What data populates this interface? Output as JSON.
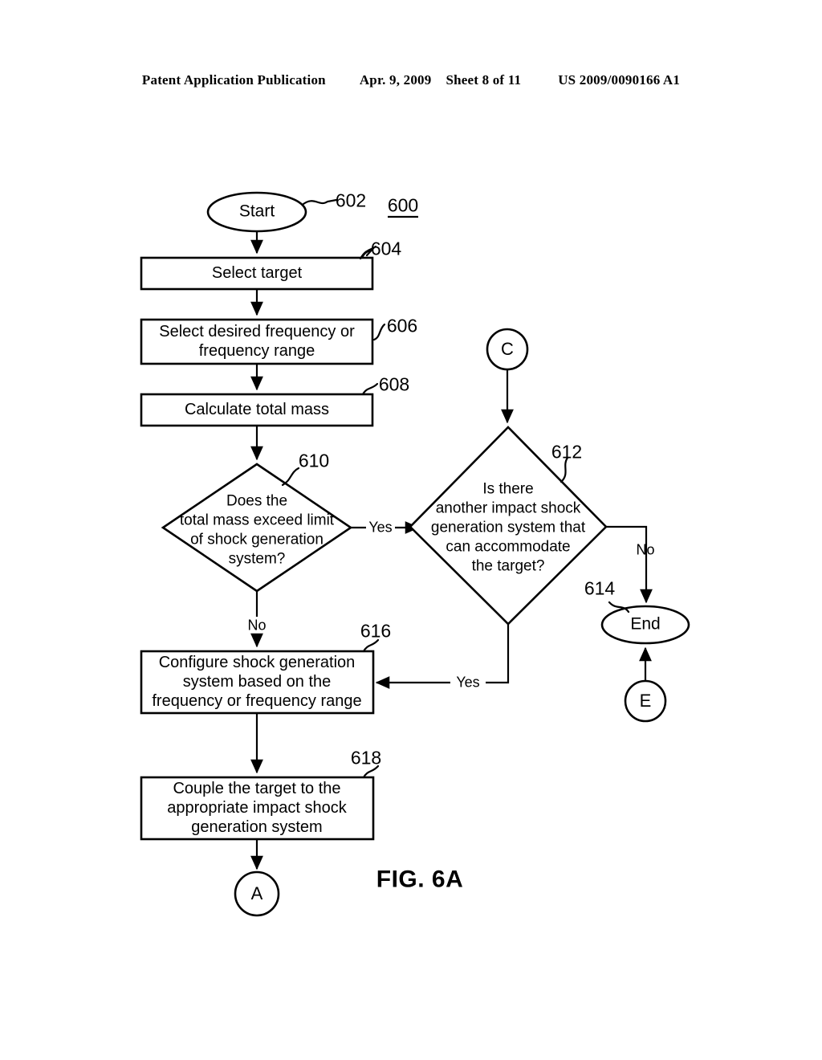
{
  "header": {
    "publication": "Patent Application Publication",
    "date": "Apr. 9, 2009",
    "sheet": "Sheet 8 of 11",
    "patent_number": "US 2009/0090166 A1"
  },
  "figure": {
    "caption": "FIG. 6A",
    "diagram_ref": "600"
  },
  "nodes": {
    "start": {
      "label": "Start",
      "ref": "602"
    },
    "select_target": {
      "label": "Select target",
      "ref": "604"
    },
    "select_frequency": {
      "line1": "Select desired frequency or",
      "line2": "frequency range",
      "ref": "606"
    },
    "calculate_mass": {
      "label": "Calculate total mass",
      "ref": "608"
    },
    "decision_mass": {
      "line1": "Does the",
      "line2": "total mass exceed limit",
      "line3": "of shock generation",
      "line4": "system?",
      "ref": "610"
    },
    "decision_another_system": {
      "line1": "Is there",
      "line2": "another impact shock",
      "line3": "generation system that",
      "line4": "can accommodate",
      "line5": "the target?",
      "ref": "612"
    },
    "end": {
      "label": "End",
      "ref": "614"
    },
    "configure_system": {
      "line1": "Configure shock generation",
      "line2": "system based on the",
      "line3": "frequency or frequency range",
      "ref": "616"
    },
    "couple_target": {
      "line1": "Couple the target to the",
      "line2": "appropriate impact shock",
      "line3": "generation system",
      "ref": "618"
    },
    "connector_c": {
      "label": "C"
    },
    "connector_e": {
      "label": "E"
    },
    "connector_a": {
      "label": "A"
    }
  },
  "edges": {
    "mass_yes": "Yes",
    "mass_no": "No",
    "another_no": "No",
    "another_yes": "Yes"
  },
  "colors": {
    "ink": "#000000",
    "paper": "#ffffff"
  }
}
